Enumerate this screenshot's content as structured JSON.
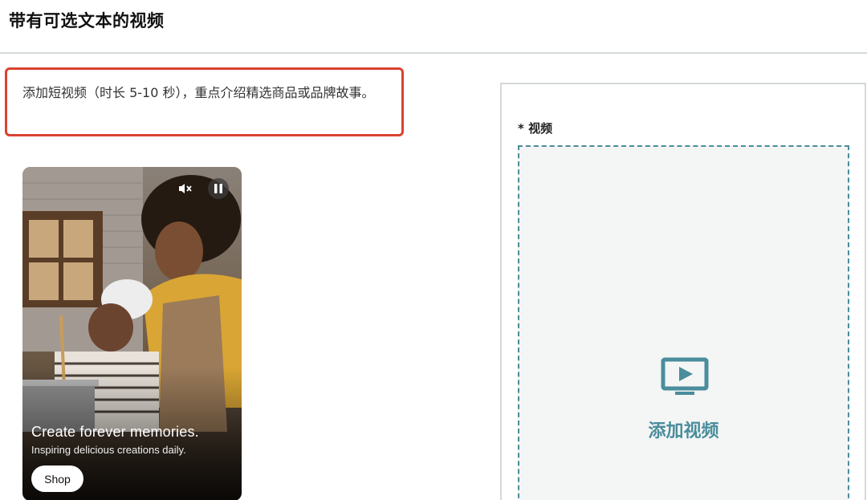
{
  "header": {
    "title": "带有可选文本的视频"
  },
  "description": {
    "text": "添加短视频（时长 5-10 秒），重点介绍精选商品或品牌故事。"
  },
  "preview": {
    "headline": "Create forever memories.",
    "subtext": "Inspiring delicious creations daily.",
    "shop_label": "Shop",
    "mute_icon": "mute-icon",
    "pause_icon": "pause-icon"
  },
  "upload": {
    "field_label": "* 视频",
    "add_label": "添加视频",
    "icon": "video-play-icon",
    "accent_color": "#4a8d9c"
  },
  "colors": {
    "highlight_border": "#d9432f"
  }
}
